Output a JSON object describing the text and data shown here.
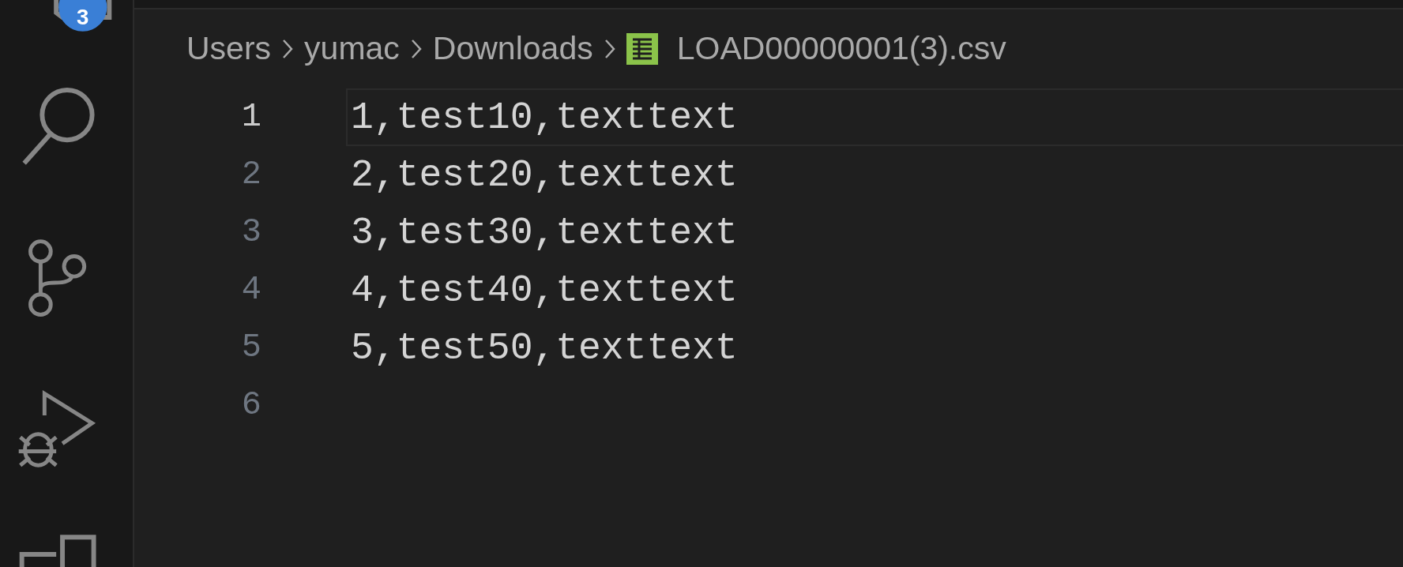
{
  "activity_bar": {
    "badge": "3"
  },
  "breadcrumb": [
    {
      "label": "Users",
      "kind": "folder"
    },
    {
      "label": "yumac",
      "kind": "folder"
    },
    {
      "label": "Downloads",
      "kind": "folder"
    },
    {
      "label": "LOAD00000001(3).csv",
      "kind": "file"
    }
  ],
  "lines": [
    {
      "number": "1",
      "code": "1,test10,texttext",
      "selected": true
    },
    {
      "number": "2",
      "code": "2,test20,texttext",
      "selected": false
    },
    {
      "number": "3",
      "code": "3,test30,texttext",
      "selected": false
    },
    {
      "number": "4",
      "code": "4,test40,texttext",
      "selected": false
    },
    {
      "number": "5",
      "code": "5,test50,texttext",
      "selected": false
    },
    {
      "number": "6",
      "selected": false
    }
  ]
}
